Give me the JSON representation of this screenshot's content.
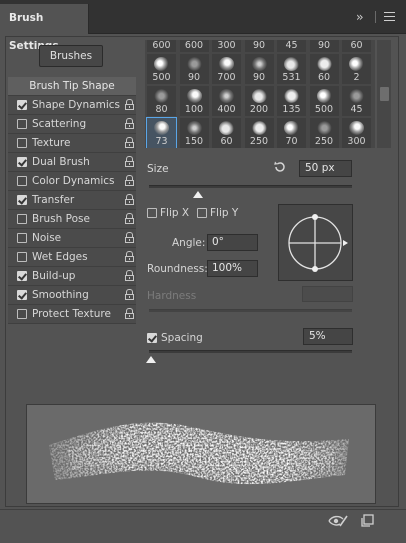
{
  "panel": {
    "title": "Brush Settings"
  },
  "brushes_button": "Brushes",
  "options": [
    {
      "label": "Brush Tip Shape",
      "has_checkbox": false,
      "checked": false,
      "has_lock": false,
      "selected": true
    },
    {
      "label": "Shape Dynamics",
      "has_checkbox": true,
      "checked": true,
      "has_lock": true
    },
    {
      "label": "Scattering",
      "has_checkbox": true,
      "checked": false,
      "has_lock": true
    },
    {
      "label": "Texture",
      "has_checkbox": true,
      "checked": false,
      "has_lock": true
    },
    {
      "label": "Dual Brush",
      "has_checkbox": true,
      "checked": true,
      "has_lock": true
    },
    {
      "label": "Color Dynamics",
      "has_checkbox": true,
      "checked": false,
      "has_lock": true
    },
    {
      "label": "Transfer",
      "has_checkbox": true,
      "checked": true,
      "has_lock": true
    },
    {
      "label": "Brush Pose",
      "has_checkbox": true,
      "checked": false,
      "has_lock": true
    },
    {
      "label": "Noise",
      "has_checkbox": true,
      "checked": false,
      "has_lock": true
    },
    {
      "label": "Wet Edges",
      "has_checkbox": true,
      "checked": false,
      "has_lock": true
    },
    {
      "label": "Build-up",
      "has_checkbox": true,
      "checked": true,
      "has_lock": true
    },
    {
      "label": "Smoothing",
      "has_checkbox": true,
      "checked": true,
      "has_lock": true
    },
    {
      "label": "Protect Texture",
      "has_checkbox": true,
      "checked": false,
      "has_lock": true
    }
  ],
  "brush_grid": {
    "rows": [
      [
        "600",
        "600",
        "300",
        "90",
        "45",
        "90",
        "60"
      ],
      [
        "500",
        "90",
        "700",
        "90",
        "531",
        "60",
        "2"
      ],
      [
        "80",
        "100",
        "400",
        "200",
        "135",
        "500",
        "45"
      ],
      [
        "73",
        "150",
        "60",
        "250",
        "70",
        "250",
        "300"
      ]
    ],
    "selected": {
      "row": 3,
      "col": 0
    }
  },
  "tip_shape": {
    "size_label": "Size",
    "size_value": "50 px",
    "size_slider_fraction": 0.24,
    "flip_x_label": "Flip X",
    "flip_x_checked": false,
    "flip_y_label": "Flip Y",
    "flip_y_checked": false,
    "angle_label": "Angle:",
    "angle_value": "0°",
    "roundness_label": "Roundness:",
    "roundness_value": "100%",
    "hardness_label": "Hardness",
    "hardness_value": "",
    "spacing_label": "Spacing",
    "spacing_checked": true,
    "spacing_value": "5%",
    "spacing_slider_fraction": 0.01
  },
  "icons": {
    "expand": "double-chevron-right-icon",
    "menu": "hamburger-menu-icon",
    "reset": "reset-size-icon",
    "eye": "toggle-live-tip-preview-icon",
    "new_preset": "create-new-brush-icon",
    "lock": "lock-icon"
  },
  "colors": {
    "panel_bg": "#535353",
    "tab_bar_bg": "#323232",
    "selection_accent": "#5aa6e8"
  }
}
